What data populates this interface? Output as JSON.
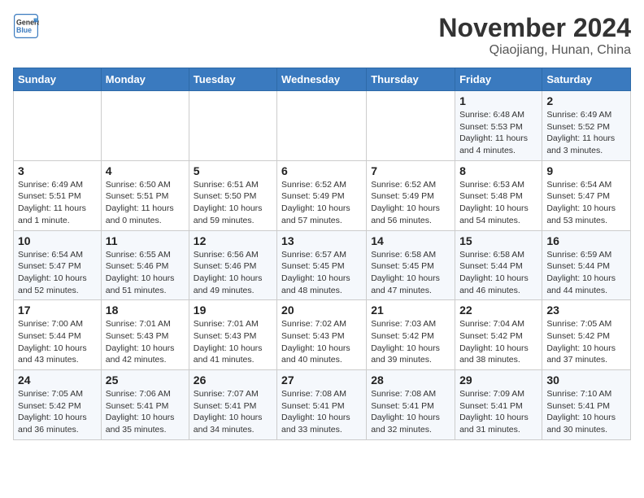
{
  "header": {
    "logo_line1": "General",
    "logo_line2": "Blue",
    "month": "November 2024",
    "location": "Qiaojiang, Hunan, China"
  },
  "columns": [
    "Sunday",
    "Monday",
    "Tuesday",
    "Wednesday",
    "Thursday",
    "Friday",
    "Saturday"
  ],
  "weeks": [
    [
      {
        "day": "",
        "detail": ""
      },
      {
        "day": "",
        "detail": ""
      },
      {
        "day": "",
        "detail": ""
      },
      {
        "day": "",
        "detail": ""
      },
      {
        "day": "",
        "detail": ""
      },
      {
        "day": "1",
        "detail": "Sunrise: 6:48 AM\nSunset: 5:53 PM\nDaylight: 11 hours\nand 4 minutes."
      },
      {
        "day": "2",
        "detail": "Sunrise: 6:49 AM\nSunset: 5:52 PM\nDaylight: 11 hours\nand 3 minutes."
      }
    ],
    [
      {
        "day": "3",
        "detail": "Sunrise: 6:49 AM\nSunset: 5:51 PM\nDaylight: 11 hours\nand 1 minute."
      },
      {
        "day": "4",
        "detail": "Sunrise: 6:50 AM\nSunset: 5:51 PM\nDaylight: 11 hours\nand 0 minutes."
      },
      {
        "day": "5",
        "detail": "Sunrise: 6:51 AM\nSunset: 5:50 PM\nDaylight: 10 hours\nand 59 minutes."
      },
      {
        "day": "6",
        "detail": "Sunrise: 6:52 AM\nSunset: 5:49 PM\nDaylight: 10 hours\nand 57 minutes."
      },
      {
        "day": "7",
        "detail": "Sunrise: 6:52 AM\nSunset: 5:49 PM\nDaylight: 10 hours\nand 56 minutes."
      },
      {
        "day": "8",
        "detail": "Sunrise: 6:53 AM\nSunset: 5:48 PM\nDaylight: 10 hours\nand 54 minutes."
      },
      {
        "day": "9",
        "detail": "Sunrise: 6:54 AM\nSunset: 5:47 PM\nDaylight: 10 hours\nand 53 minutes."
      }
    ],
    [
      {
        "day": "10",
        "detail": "Sunrise: 6:54 AM\nSunset: 5:47 PM\nDaylight: 10 hours\nand 52 minutes."
      },
      {
        "day": "11",
        "detail": "Sunrise: 6:55 AM\nSunset: 5:46 PM\nDaylight: 10 hours\nand 51 minutes."
      },
      {
        "day": "12",
        "detail": "Sunrise: 6:56 AM\nSunset: 5:46 PM\nDaylight: 10 hours\nand 49 minutes."
      },
      {
        "day": "13",
        "detail": "Sunrise: 6:57 AM\nSunset: 5:45 PM\nDaylight: 10 hours\nand 48 minutes."
      },
      {
        "day": "14",
        "detail": "Sunrise: 6:58 AM\nSunset: 5:45 PM\nDaylight: 10 hours\nand 47 minutes."
      },
      {
        "day": "15",
        "detail": "Sunrise: 6:58 AM\nSunset: 5:44 PM\nDaylight: 10 hours\nand 46 minutes."
      },
      {
        "day": "16",
        "detail": "Sunrise: 6:59 AM\nSunset: 5:44 PM\nDaylight: 10 hours\nand 44 minutes."
      }
    ],
    [
      {
        "day": "17",
        "detail": "Sunrise: 7:00 AM\nSunset: 5:44 PM\nDaylight: 10 hours\nand 43 minutes."
      },
      {
        "day": "18",
        "detail": "Sunrise: 7:01 AM\nSunset: 5:43 PM\nDaylight: 10 hours\nand 42 minutes."
      },
      {
        "day": "19",
        "detail": "Sunrise: 7:01 AM\nSunset: 5:43 PM\nDaylight: 10 hours\nand 41 minutes."
      },
      {
        "day": "20",
        "detail": "Sunrise: 7:02 AM\nSunset: 5:43 PM\nDaylight: 10 hours\nand 40 minutes."
      },
      {
        "day": "21",
        "detail": "Sunrise: 7:03 AM\nSunset: 5:42 PM\nDaylight: 10 hours\nand 39 minutes."
      },
      {
        "day": "22",
        "detail": "Sunrise: 7:04 AM\nSunset: 5:42 PM\nDaylight: 10 hours\nand 38 minutes."
      },
      {
        "day": "23",
        "detail": "Sunrise: 7:05 AM\nSunset: 5:42 PM\nDaylight: 10 hours\nand 37 minutes."
      }
    ],
    [
      {
        "day": "24",
        "detail": "Sunrise: 7:05 AM\nSunset: 5:42 PM\nDaylight: 10 hours\nand 36 minutes."
      },
      {
        "day": "25",
        "detail": "Sunrise: 7:06 AM\nSunset: 5:41 PM\nDaylight: 10 hours\nand 35 minutes."
      },
      {
        "day": "26",
        "detail": "Sunrise: 7:07 AM\nSunset: 5:41 PM\nDaylight: 10 hours\nand 34 minutes."
      },
      {
        "day": "27",
        "detail": "Sunrise: 7:08 AM\nSunset: 5:41 PM\nDaylight: 10 hours\nand 33 minutes."
      },
      {
        "day": "28",
        "detail": "Sunrise: 7:08 AM\nSunset: 5:41 PM\nDaylight: 10 hours\nand 32 minutes."
      },
      {
        "day": "29",
        "detail": "Sunrise: 7:09 AM\nSunset: 5:41 PM\nDaylight: 10 hours\nand 31 minutes."
      },
      {
        "day": "30",
        "detail": "Sunrise: 7:10 AM\nSunset: 5:41 PM\nDaylight: 10 hours\nand 30 minutes."
      }
    ]
  ]
}
